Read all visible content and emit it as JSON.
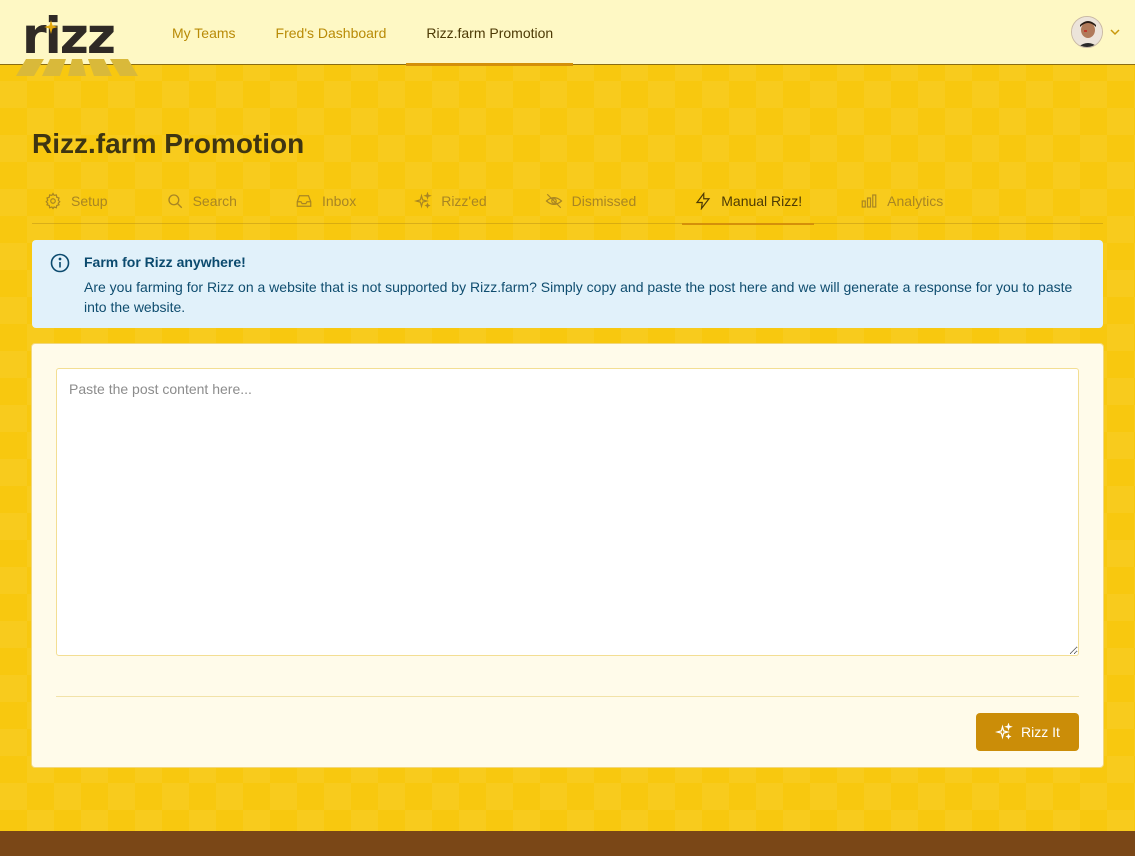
{
  "logo": {
    "text": "rizz"
  },
  "nav": {
    "items": [
      {
        "label": "My Teams"
      },
      {
        "label": "Fred's Dashboard"
      },
      {
        "label": "Rizz.farm Promotion"
      }
    ]
  },
  "page": {
    "title": "Rizz.farm Promotion"
  },
  "tabs": [
    {
      "label": "Setup",
      "icon": "gear-icon"
    },
    {
      "label": "Search",
      "icon": "search-icon"
    },
    {
      "label": "Inbox",
      "icon": "inbox-icon"
    },
    {
      "label": "Rizz'ed",
      "icon": "sparkles-icon"
    },
    {
      "label": "Dismissed",
      "icon": "eye-off-icon"
    },
    {
      "label": "Manual Rizz!",
      "icon": "bolt-icon"
    },
    {
      "label": "Analytics",
      "icon": "bar-chart-icon"
    }
  ],
  "alert": {
    "title": "Farm for Rizz anywhere!",
    "text": "Are you farming for Rizz on a website that is not supported by Rizz.farm? Simply copy and paste the post here and we will generate a response for you to paste into the website."
  },
  "form": {
    "placeholder": "Paste the post content here...",
    "value": "",
    "submit_label": "Rizz It"
  },
  "colors": {
    "accent": "#cb8d08",
    "background": "#f8c80f",
    "topbar": "#fef8c4",
    "alert_bg": "#e1f1fa",
    "footer": "#7a4717"
  }
}
